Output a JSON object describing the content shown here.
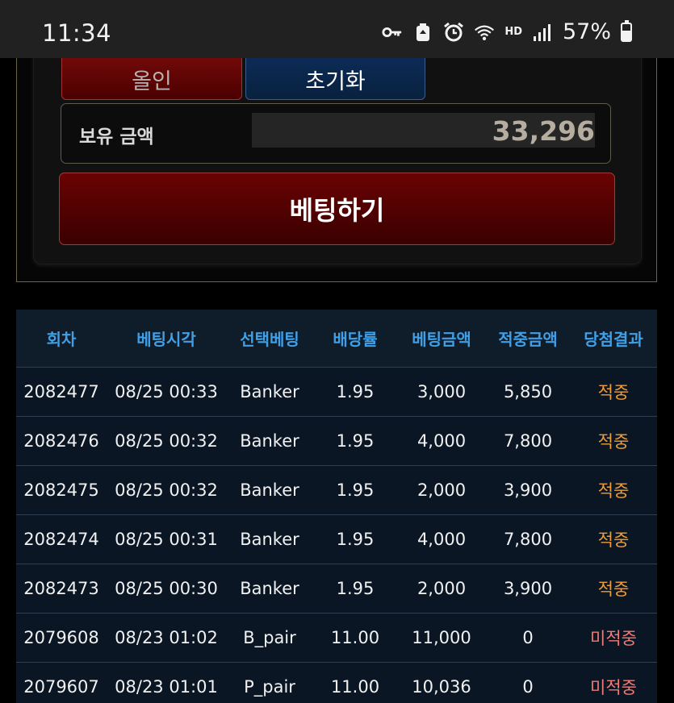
{
  "status_bar": {
    "time": "11:34",
    "network": "HD",
    "battery_text": "57%",
    "battery_level": 0.57,
    "icons": [
      "key-icon",
      "recycle-icon",
      "alarm-icon",
      "wifi-icon",
      "signal-icon",
      "battery-icon"
    ]
  },
  "bet_panel": {
    "allin_label": "올인",
    "reset_label": "초기화",
    "balance_label": "보유 금액",
    "balance_value": "33,296",
    "bet_label": "베팅하기"
  },
  "history": {
    "columns": [
      "회차",
      "베팅시각",
      "선택베팅",
      "배당률",
      "베팅금액",
      "적중금액",
      "당첨결과"
    ],
    "rows": [
      {
        "round": "2082477",
        "time": "08/25 00:33",
        "pick": "Banker",
        "odds": "1.95",
        "amount": "3,000",
        "payout": "5,850",
        "result": "적중",
        "win": true
      },
      {
        "round": "2082476",
        "time": "08/25 00:32",
        "pick": "Banker",
        "odds": "1.95",
        "amount": "4,000",
        "payout": "7,800",
        "result": "적중",
        "win": true
      },
      {
        "round": "2082475",
        "time": "08/25 00:32",
        "pick": "Banker",
        "odds": "1.95",
        "amount": "2,000",
        "payout": "3,900",
        "result": "적중",
        "win": true
      },
      {
        "round": "2082474",
        "time": "08/25 00:31",
        "pick": "Banker",
        "odds": "1.95",
        "amount": "4,000",
        "payout": "7,800",
        "result": "적중",
        "win": true
      },
      {
        "round": "2082473",
        "time": "08/25 00:30",
        "pick": "Banker",
        "odds": "1.95",
        "amount": "2,000",
        "payout": "3,900",
        "result": "적중",
        "win": true
      },
      {
        "round": "2079608",
        "time": "08/23 01:02",
        "pick": "B_pair",
        "odds": "11.00",
        "amount": "11,000",
        "payout": "0",
        "result": "미적중",
        "win": false
      },
      {
        "round": "2079607",
        "time": "08/23 01:01",
        "pick": "P_pair",
        "odds": "11.00",
        "amount": "10,036",
        "payout": "0",
        "result": "미적중",
        "win": false
      }
    ]
  }
}
